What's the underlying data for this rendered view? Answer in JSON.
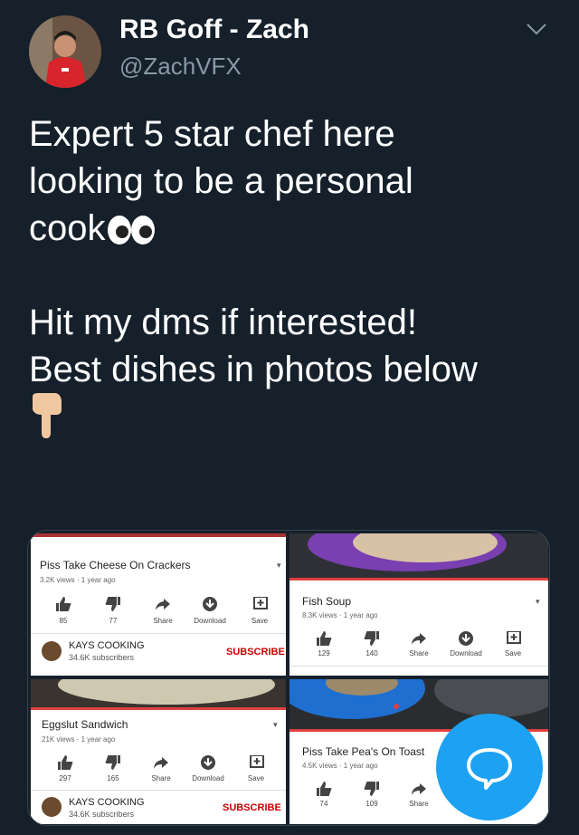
{
  "author": {
    "display_name": "RB Goff - Zach",
    "handle": "@ZachVFX"
  },
  "tweet": {
    "lines": [
      "Expert 5 star chef here",
      "looking to be a personal",
      "cook",
      "",
      "Hit my dms if interested!",
      "Best dishes in photos below"
    ],
    "emoji": [
      "eyes-emoji",
      "pointing-down-emoji"
    ]
  },
  "videos": [
    {
      "title": "Piss Take Cheese On Crackers",
      "meta": "3.2K views · 1 year ago",
      "likes": "85",
      "dislikes": "77",
      "share": "Share",
      "download": "Download",
      "save": "Save",
      "channel": "KAYS COOKING",
      "subscribers": "34.6K subscribers",
      "subscribe": "SUBSCRIBE"
    },
    {
      "title": "Fish Soup",
      "meta": "8.3K views · 1 year ago",
      "likes": "129",
      "dislikes": "140",
      "share": "Share",
      "download": "Download",
      "save": "Save"
    },
    {
      "title": "Eggslut Sandwich",
      "meta": "21K views · 1 year ago",
      "likes": "297",
      "dislikes": "165",
      "share": "Share",
      "download": "Download",
      "save": "Save",
      "channel": "KAYS COOKING",
      "subscribers": "34.6K subscribers",
      "subscribe": "SUBSCRIBE"
    },
    {
      "title": "Piss Take Pea's On Toast",
      "meta": "4.5K views · 1 year ago",
      "likes": "74",
      "dislikes": "109",
      "share": "Share"
    }
  ],
  "colors": {
    "background": "#15202b",
    "accent": "#1da1f2",
    "subscribe": "#cc0000",
    "secondary_text": "#8899a6"
  }
}
